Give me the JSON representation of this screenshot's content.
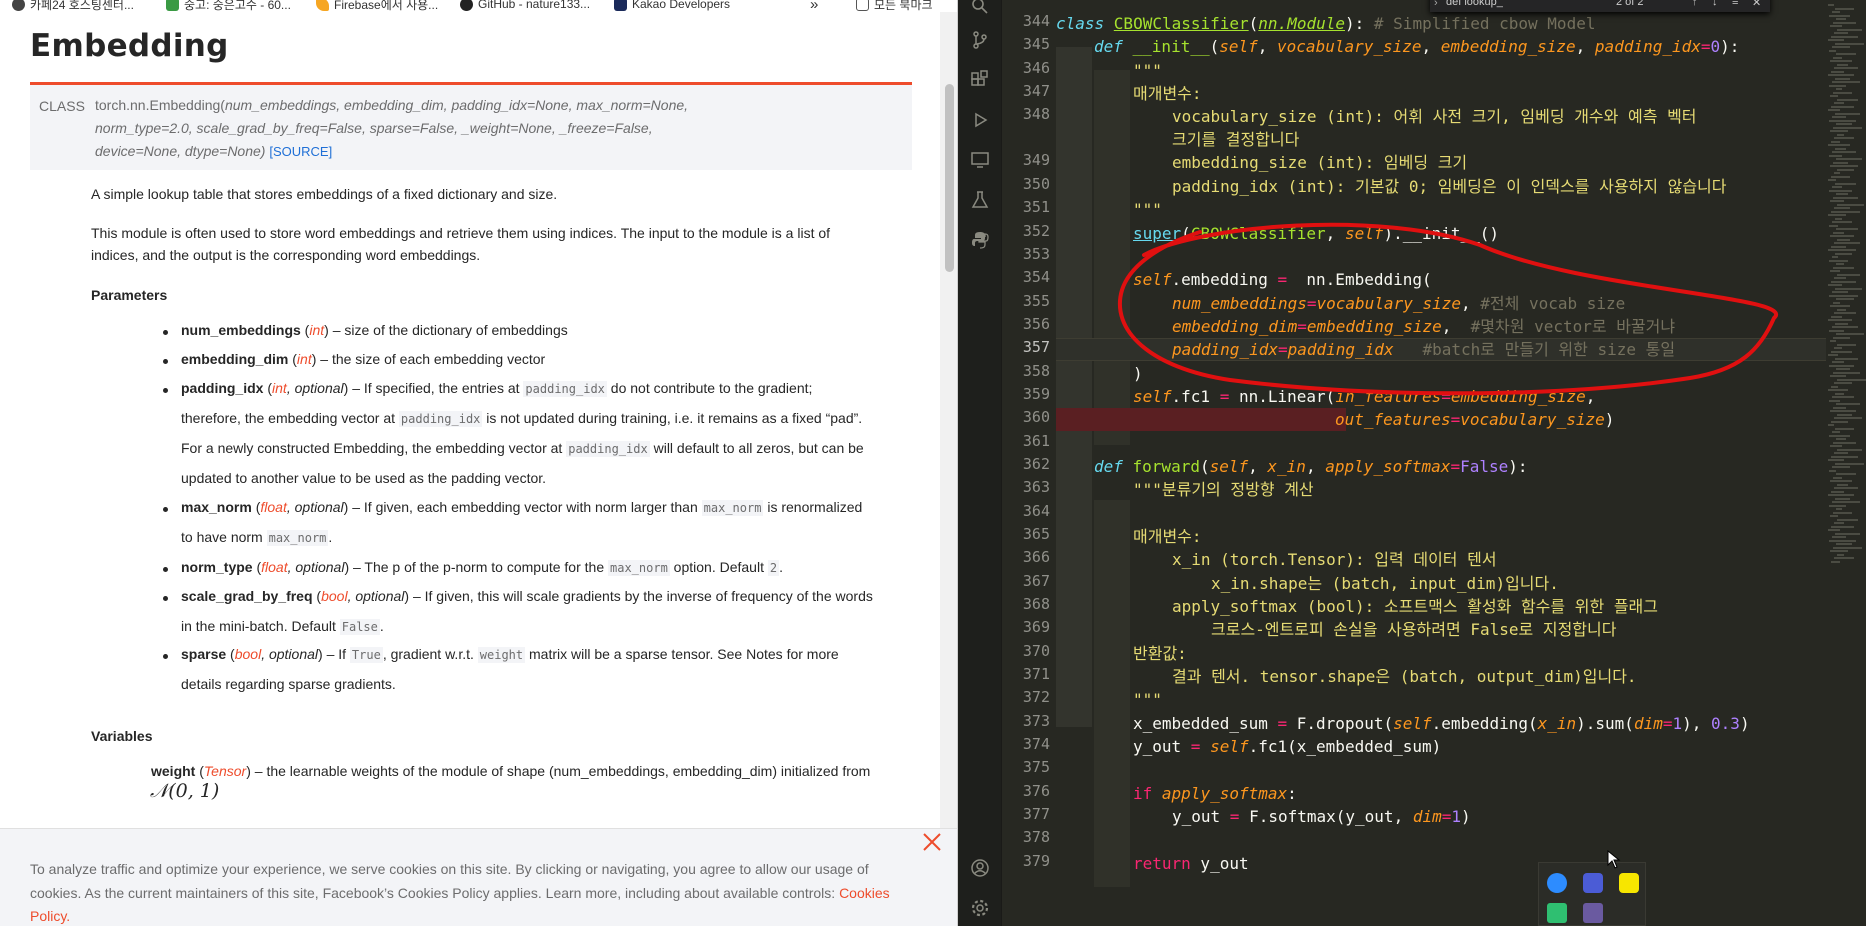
{
  "bookmarks": [
    {
      "label": "카페24 호스팅센터...",
      "icon": "cafe24-icon"
    },
    {
      "label": "숭고: 숭은고수 - 60...",
      "icon": "blog-icon"
    },
    {
      "label": "Firebase에서 사용...",
      "icon": "firebase-icon"
    },
    {
      "label": "GitHub - nature133...",
      "icon": "github-icon"
    },
    {
      "label": "Kakao Developers",
      "icon": "kakao-icon"
    },
    {
      "label": "»"
    },
    {
      "label": "모든 북마크",
      "icon": "folder-icon"
    }
  ],
  "doc": {
    "title": "Embedding",
    "class_tag": "CLASS",
    "signature": {
      "line1_prefix": "torch.nn.Embedding(",
      "line1": "num_embeddings, embedding_dim, padding_idx=None, max_norm=None,",
      "line2": "norm_type=2.0, scale_grad_by_freq=False, sparse=False, _weight=None, _freeze=False,",
      "line3": "device=None, dtype=None)",
      "source": "[SOURCE]"
    },
    "desc1": "A simple lookup table that stores embeddings of a fixed dictionary and size.",
    "desc2a": "This module is often used to store word embeddings and retrieve them using indices. The input to the module is a list of",
    "desc2b": "indices, and the output is the corresponding word embeddings.",
    "params_heading": "Parameters",
    "params": {
      "num_embeddings": {
        "name": "num_embeddings",
        "type": "int",
        "text": " – size of the dictionary of embeddings"
      },
      "embedding_dim": {
        "name": "embedding_dim",
        "type": "int",
        "text": " – the size of each embedding vector"
      },
      "padding_idx": {
        "name": "padding_idx",
        "type": "int",
        "opt": ", optional",
        "l1a": " – If specified, the entries at ",
        "l1code": "padding_idx",
        "l1b": " do not contribute to the gradient;",
        "l2a": "therefore, the embedding vector at ",
        "l2code": "padding_idx",
        "l2b": " is not updated during training, i.e. it remains as a fixed “pad”.",
        "l3a": "For a newly constructed Embedding, the embedding vector at ",
        "l3code": "padding_idx",
        "l3b": " will default to all zeros, but can be",
        "l4": "updated to another value to be used as the padding vector."
      },
      "max_norm": {
        "name": "max_norm",
        "type": "float",
        "opt": ", optional",
        "l1a": " – If given, each embedding vector with norm larger than ",
        "l1code": "max_norm",
        "l1b": " is renormalized",
        "l2a": "to have norm ",
        "l2code": "max_norm",
        "l2b": "."
      },
      "norm_type": {
        "name": "norm_type",
        "type": "float",
        "opt": ", optional",
        "l1a": " – The p of the p-norm to compute for the ",
        "l1code": "max_norm",
        "l1b": " option. Default ",
        "l1code2": "2",
        "l1c": "."
      },
      "scale_grad_by_freq": {
        "name": "scale_grad_by_freq",
        "type": "bool",
        "opt": ", optional",
        "l1": " – If given, this will scale gradients by the inverse of frequency of the words",
        "l2a": "in the mini-batch. Default ",
        "l2code": "False",
        "l2b": "."
      },
      "sparse": {
        "name": "sparse",
        "type": "bool",
        "opt": ", optional",
        "l1a": " – If ",
        "l1code": "True",
        "l1b": ", gradient w.r.t. ",
        "l1code2": "weight",
        "l1c": " matrix will be a sparse tensor. See Notes for more",
        "l2": "details regarding sparse gradients."
      }
    },
    "variables_heading": "Variables",
    "weight": {
      "name": "weight",
      "type": "Tensor",
      "text": " – the learnable weights of the module of shape (num_embeddings, embedding_dim) initialized from"
    },
    "math": "𝒩(0, 1)"
  },
  "cookie": {
    "line1": "To analyze traffic and optimize your experience, we serve cookies on this site. By clicking or navigating, you agree to allow our usage of",
    "line2": "cookies. As the current maintainers of this site, Facebook’s Cookies Policy applies. Learn more, including about available controls: ",
    "link_a": "Cookies",
    "link_b": "Policy."
  },
  "editor": {
    "find_text": "def lookup_",
    "find_count": "2 of 2",
    "current_line": 357,
    "line_numbers": [
      344,
      345,
      346,
      347,
      348,
      "",
      349,
      350,
      351,
      352,
      353,
      354,
      355,
      356,
      357,
      358,
      359,
      360,
      361,
      362,
      363,
      364,
      365,
      366,
      367,
      368,
      369,
      370,
      371,
      372,
      373,
      374,
      375,
      376,
      377,
      378,
      379
    ],
    "code": {
      "l344_kw": "class ",
      "l344_cls": "CBOWClassifier",
      "l344_p1": "(",
      "l344_base": "nn.Module",
      "l344_p2": "): ",
      "l344_cm": "# Simplified cbow Model",
      "l345_def": "def ",
      "l345_fn": "__init__",
      "l345_a": "(",
      "l345_self": "self",
      "l345_b": ", ",
      "l345_v": "vocabulary_size",
      "l345_c": ", ",
      "l345_e": "embedding_size",
      "l345_d": ", ",
      "l345_p": "padding_idx",
      "l345_eq": "=",
      "l345_n": "0",
      "l345_z": "):",
      "l346": "\"\"\"",
      "l347": "매개변수:",
      "l348a": "vocabulary_size (int): 어휘 사전 크기, 임베딩 개수와 예측 벡터",
      "l348b": "크기를 결정합니다",
      "l349": "embedding_size (int): 임베딩 크기",
      "l350": "padding_idx (int): 기본값 0; 임베딩은 이 인덱스를 사용하지 않습니다",
      "l351": "\"\"\"",
      "l352_super": "super",
      "l352_a": "(",
      "l352_cls": "CBOWClassifier",
      "l352_b": ", ",
      "l352_self": "self",
      "l352_c": ").__init__()",
      "l354_self": "self",
      "l354_a": ".embedding ",
      "l354_eq": "=",
      "l354_b": "  nn.Embedding(",
      "l355_k": "num_embeddings",
      "l355_eq": "=",
      "l355_v": "vocabulary_size",
      "l355_c": ", ",
      "l355_cm": "#전체 vocab size",
      "l356_k": "embedding_dim",
      "l356_eq": "=",
      "l356_v": "embedding_size",
      "l356_c": ",  ",
      "l356_cm": "#몇차원 vector로 바꿀거냐",
      "l357_k": "padding_idx",
      "l357_eq": "=",
      "l357_v": "padding_idx",
      "l357_sp": "   ",
      "l357_cm": "#batch로 만들기 위한 size 통일",
      "l358": ")",
      "l359_self": "self",
      "l359_a": ".fc1 ",
      "l359_eq": "=",
      "l359_b": " nn.Linear(",
      "l359_k": "in_features",
      "l359_eq2": "=",
      "l359_v": "embedding_size",
      "l359_c": ",",
      "l360_k": "out_features",
      "l360_eq": "=",
      "l360_v": "vocabulary_size",
      "l360_c": ")",
      "l362_def": "def ",
      "l362_fn": "forward",
      "l362_a": "(",
      "l362_self": "self",
      "l362_b": ", ",
      "l362_x": "x_in",
      "l362_c": ", ",
      "l362_s": "apply_softmax",
      "l362_eq": "=",
      "l362_f": "False",
      "l362_d": "):",
      "l363": "\"\"\"분류기의 정방향 계산",
      "l365": "매개변수:",
      "l366": "x_in (torch.Tensor): 입력 데이터 텐서",
      "l367": "x_in.shape는 (batch, input_dim)입니다.",
      "l368": "apply_softmax (bool): 소프트맥스 활성화 함수를 위한 플래그",
      "l369": "크로스-엔트로피 손실을 사용하려면 False로 지정합니다",
      "l370": "반환값:",
      "l371": "결과 텐서. tensor.shape은 (batch, output_dim)입니다.",
      "l372": "\"\"\"",
      "l373_a": "x_embedded_sum ",
      "l373_eq": "=",
      "l373_b": " F.dropout(",
      "l373_self": "self",
      "l373_c": ".embedding(",
      "l373_x": "x_in",
      "l373_d": ").sum(",
      "l373_k": "dim",
      "l373_eq2": "=",
      "l373_n": "1",
      "l373_e": "), ",
      "l373_n2": "0.3",
      "l373_f": ")",
      "l374_a": "y_out ",
      "l374_eq": "=",
      "l374_b": " ",
      "l374_self": "self",
      "l374_c": ".fc1(x_embedded_sum)",
      "l376_if": "if ",
      "l376_v": "apply_softmax",
      "l376_c": ":",
      "l377_a": "y_out ",
      "l377_eq": "=",
      "l377_b": " F.softmax(y_out, ",
      "l377_k": "dim",
      "l377_eq2": "=",
      "l377_n": "1",
      "l377_c": ")",
      "l379_ret": "return",
      "l379_v": " y_out"
    }
  },
  "colors": {
    "pytorch_orange": "#ee4c2c",
    "monokai_bg": "#272822",
    "annotation_red": "#e01010"
  }
}
